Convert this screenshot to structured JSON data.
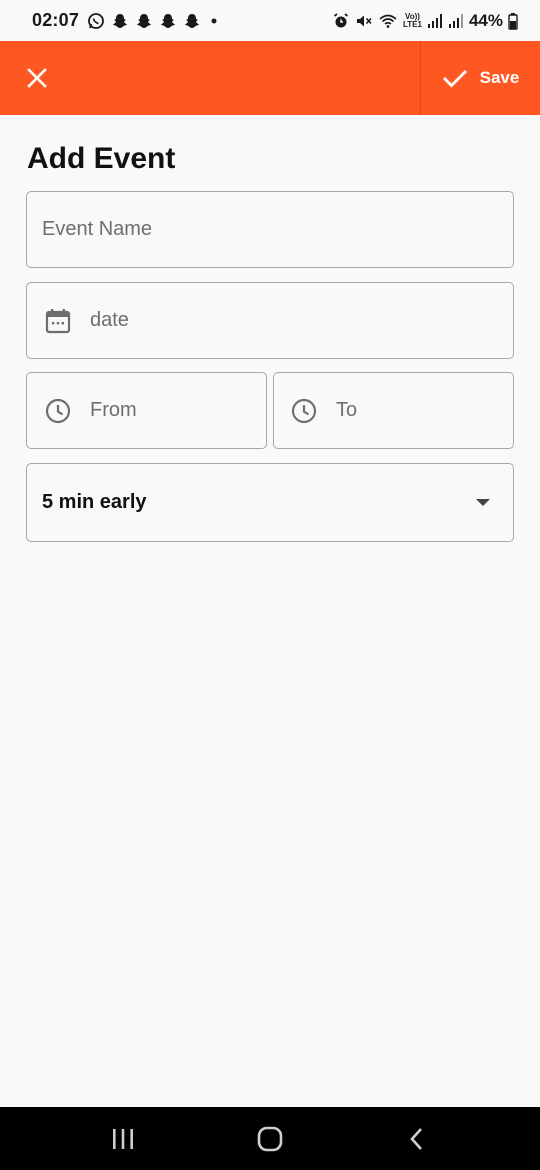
{
  "status_bar": {
    "time": "02:07",
    "volte_top": "Vo))",
    "volte_bottom": "LTE1",
    "battery": "44%",
    "icons": [
      "whatsapp-icon",
      "snapchat-icon",
      "snapchat-icon",
      "snapchat-icon",
      "snapchat-icon",
      "dot-icon",
      "alarm-icon",
      "mute-icon",
      "wifi-icon",
      "signal-icon",
      "signal-icon",
      "battery-icon"
    ]
  },
  "app_bar": {
    "close_icon": "close-icon",
    "save_icon": "check-icon",
    "save_label": "Save",
    "color": "#ff5722"
  },
  "form": {
    "title": "Add Event",
    "event_name_placeholder": "Event Name",
    "date_placeholder": "date",
    "from_placeholder": "From",
    "to_placeholder": "To",
    "reminder_value": "5 min early",
    "date_icon": "calendar-icon",
    "time_icon": "clock-icon",
    "reminder_icon": "dropdown-arrow-icon"
  },
  "nav_bar": {
    "icons": [
      "recent-apps-icon",
      "home-icon",
      "back-icon"
    ]
  }
}
